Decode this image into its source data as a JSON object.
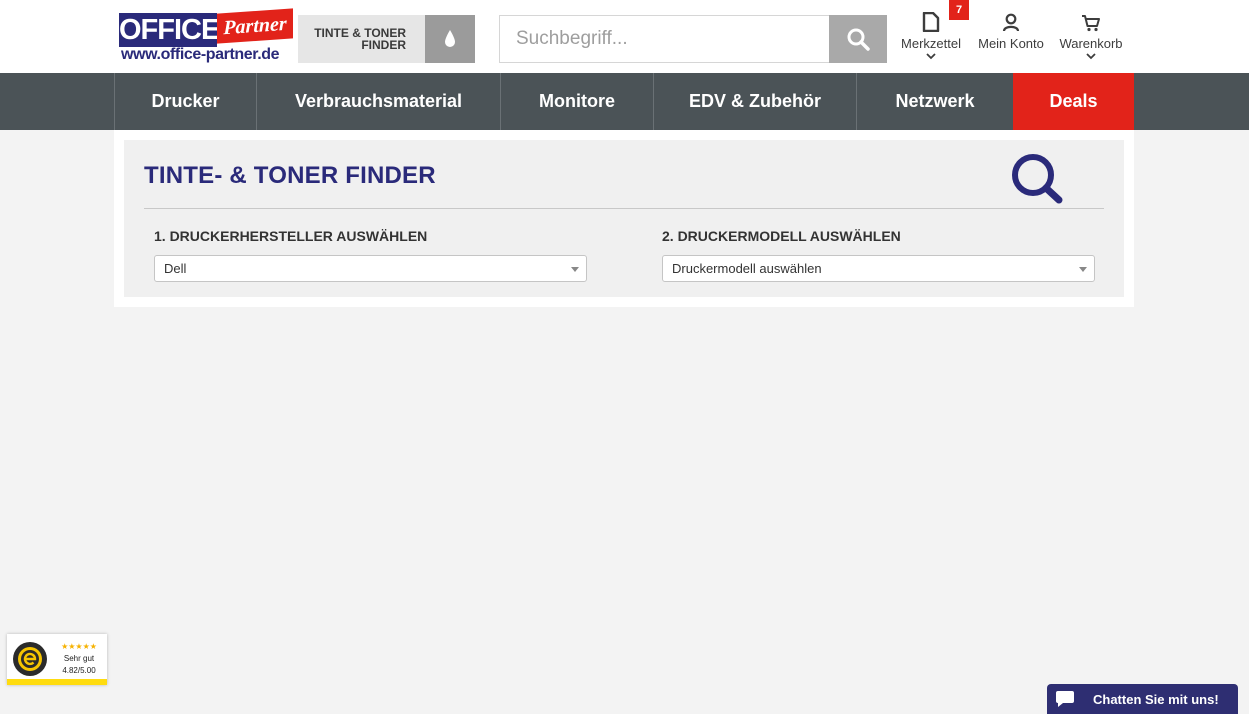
{
  "logo": {
    "word1": "OFFICE",
    "word2": "Partner",
    "url": "www.office-partner.de"
  },
  "finder_button": {
    "line1": "TINTE & TONER",
    "line2": "FINDER"
  },
  "search": {
    "placeholder": "Suchbegriff..."
  },
  "header_actions": {
    "wishlist": {
      "label": "Merkzettel",
      "badge": "7"
    },
    "account": {
      "label": "Mein Konto"
    },
    "cart": {
      "label": "Warenkorb"
    }
  },
  "nav": {
    "items": [
      {
        "label": "Drucker"
      },
      {
        "label": "Verbrauchsmaterial"
      },
      {
        "label": "Monitore"
      },
      {
        "label": "EDV & Zubehör"
      },
      {
        "label": "Netzwerk"
      },
      {
        "label": "Deals"
      }
    ]
  },
  "finder_panel": {
    "title": "TINTE- & TONER FINDER",
    "manufacturer": {
      "label": "1. DRUCKERHERSTELLER AUSWÄHLEN",
      "value": "Dell"
    },
    "model": {
      "label": "2. DRUCKERMODELL AUSWÄHLEN",
      "value": "Druckermodell auswählen"
    }
  },
  "trust_badge": {
    "stars": "★★★★★",
    "rating_text": "Sehr gut",
    "score": "4.82/5.00"
  },
  "chat": {
    "label": "Chatten Sie mit uns!"
  },
  "colors": {
    "brand_blue": "#2a2a7a",
    "brand_red": "#e2231a",
    "nav_bg": "#4b5357"
  }
}
